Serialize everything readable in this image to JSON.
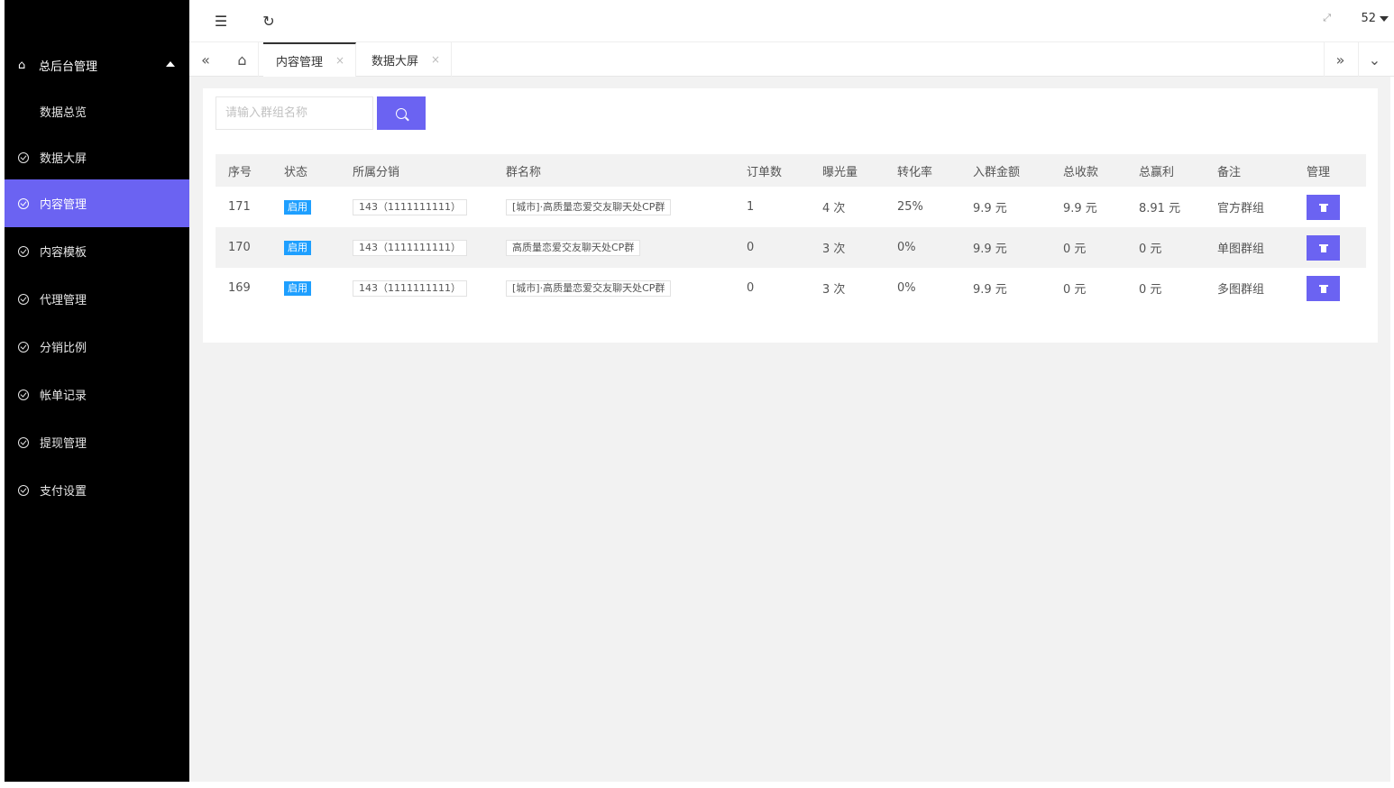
{
  "sidebar": {
    "group": {
      "label": "总后台管理",
      "sub_items": [
        "数据总览"
      ]
    },
    "items": [
      {
        "label": "数据大屏"
      },
      {
        "label": "内容管理",
        "active": true
      },
      {
        "label": "内容模板"
      },
      {
        "label": "代理管理"
      },
      {
        "label": "分销比例"
      },
      {
        "label": "帐单记录"
      },
      {
        "label": "提现管理"
      },
      {
        "label": "支付设置"
      }
    ]
  },
  "header": {
    "menu_icon": "indent-icon",
    "refresh_icon": "refresh-icon",
    "fullscreen_icon": "fullscreen-icon",
    "user_label": "52"
  },
  "tabs": [
    {
      "label": "内容管理",
      "active": true
    },
    {
      "label": "数据大屏",
      "active": false
    }
  ],
  "search": {
    "placeholder": "请输入群组名称"
  },
  "table": {
    "columns": [
      "序号",
      "状态",
      "所属分销",
      "群名称",
      "订单数",
      "曝光量",
      "转化率",
      "入群金额",
      "总收款",
      "总赢利",
      "备注",
      "管理"
    ],
    "rows": [
      {
        "id": "171",
        "status": "启用",
        "distributor": "143（1111111111）",
        "group_name": "[城市]·高质量恋爱交友聊天处CP群",
        "orders": "1",
        "exposure": "4 次",
        "conversion": "25%",
        "amount": "9.9 元",
        "total_income": "9.9 元",
        "total_profit": "8.91 元",
        "note": "官方群组"
      },
      {
        "id": "170",
        "status": "启用",
        "distributor": "143（1111111111）",
        "group_name": "高质量恋爱交友聊天处CP群",
        "orders": "0",
        "exposure": "3 次",
        "conversion": "0%",
        "amount": "9.9 元",
        "total_income": "0 元",
        "total_profit": "0 元",
        "note": "单图群组"
      },
      {
        "id": "169",
        "status": "启用",
        "distributor": "143（1111111111）",
        "group_name": "[城市]·高质量恋爱交友聊天处CP群",
        "orders": "0",
        "exposure": "3 次",
        "conversion": "0%",
        "amount": "9.9 元",
        "total_income": "0 元",
        "total_profit": "0 元",
        "note": "多图群组"
      }
    ]
  },
  "colors": {
    "accent": "#6b63f2",
    "sidebar_bg": "#000000",
    "badge": "#1e9fff"
  }
}
